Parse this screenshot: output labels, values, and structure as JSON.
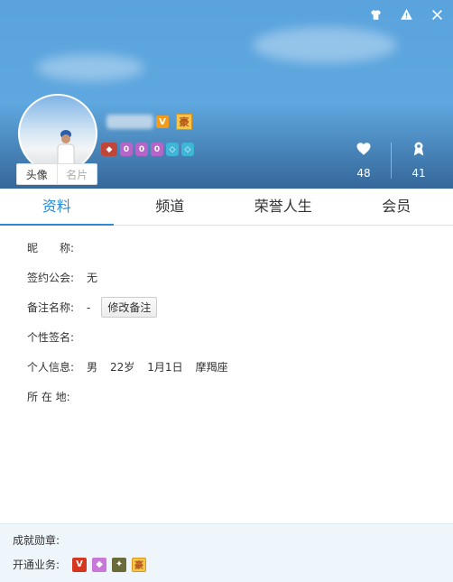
{
  "avatar_tabs": [
    "头像",
    "名片"
  ],
  "badges": {
    "v_label": "V",
    "hao_label": "豪"
  },
  "stats": {
    "likes": "48",
    "honors": "41"
  },
  "tabs": [
    "资料",
    "频道",
    "荣誉人生",
    "会员"
  ],
  "profile": {
    "nickname_label": "昵　　称:",
    "guild_label": "签约公会:",
    "guild_value": "无",
    "remark_label": "备注名称:",
    "remark_value": "-",
    "remark_button": "修改备注",
    "signature_label": "个性签名:",
    "personal_label": "个人信息:",
    "gender": "男",
    "age": "22岁",
    "birthday": "1月1日",
    "zodiac": "摩羯座",
    "location_label": "所 在 地:"
  },
  "footer": {
    "achievements_label": "成就勋章:",
    "services_label": "开通业务:",
    "service_hao": "豪"
  },
  "icons": [
    "shirt-icon",
    "warning-icon",
    "close-icon",
    "heart-icon",
    "award-icon"
  ],
  "colors": {
    "accent": "#2e8ad8",
    "header_top": "#5aa3dd",
    "footer_bg": "#eef5fb"
  }
}
